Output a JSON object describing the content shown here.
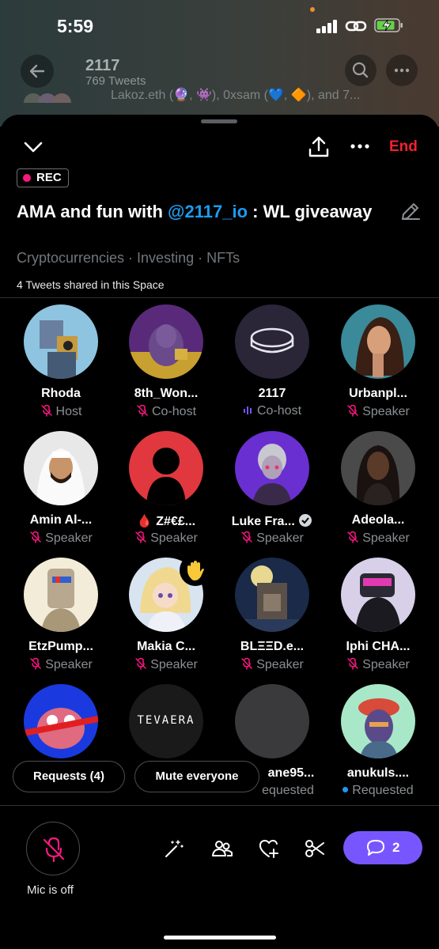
{
  "status_bar": {
    "time": "5:59"
  },
  "behind": {
    "title": "2117",
    "subtitle": "769 Tweets",
    "partial_line": "Lakoz.eth (🔮, 👾), 0xsam (💙, 🔶), and 7..."
  },
  "header": {
    "end_label": "End"
  },
  "space": {
    "rec_label": "REC",
    "title_pre": "AMA and fun with ",
    "title_mention": "@2117_io",
    "title_post": " : WL giveaway",
    "topics": "Cryptocurrencies · Investing · NFTs",
    "shared": "4 Tweets shared in this Space"
  },
  "participants": [
    {
      "name": "Rhoda",
      "role": "Host"
    },
    {
      "name": "8th_Won...",
      "role": "Co-host"
    },
    {
      "name": "2117",
      "role": "Co-host"
    },
    {
      "name": "Urbanpl...",
      "role": "Speaker"
    },
    {
      "name": "Amin Al-...",
      "role": "Speaker"
    },
    {
      "name": "🩸 Z#€£...",
      "role": "Speaker"
    },
    {
      "name": "Luke Fra...",
      "role": "Speaker"
    },
    {
      "name": "Adeola...",
      "role": "Speaker"
    },
    {
      "name": "EtzPump...",
      "role": "Speaker"
    },
    {
      "name": "Makia C...",
      "role": "Speaker"
    },
    {
      "name": "BLΞΞD.e...",
      "role": "Speaker"
    },
    {
      "name": "Iphi CHA...",
      "role": "Speaker"
    },
    {
      "name": "",
      "role": ""
    },
    {
      "name": "",
      "role": ""
    },
    {
      "name": "ane95...",
      "role": "equested"
    },
    {
      "name": "anukuls....",
      "role": "Requested"
    }
  ],
  "tevaera_text": "TEVAERA",
  "requests_label": "Requests (4)",
  "mute_label": "Mute everyone",
  "mic_label": "Mic is off",
  "chat_count": "2",
  "colors": {
    "accent_red": "#f4212e",
    "mention_blue": "#1d9bf0",
    "chat_purple": "#7856ff",
    "rec_pink": "#f91880"
  }
}
